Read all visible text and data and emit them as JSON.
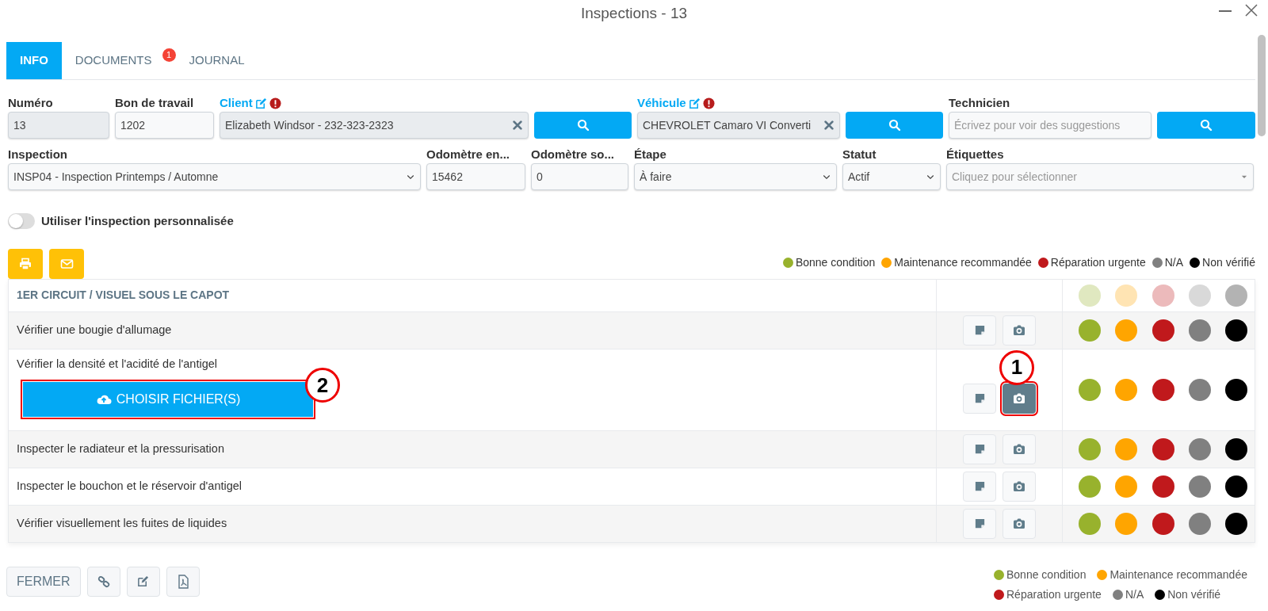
{
  "window": {
    "title": "Inspections - 13"
  },
  "tabs": [
    {
      "label": "INFO",
      "selected": true
    },
    {
      "label": "DOCUMENTS",
      "selected": false,
      "badge": "1"
    },
    {
      "label": "JOURNAL",
      "selected": false
    }
  ],
  "fields_row1": [
    {
      "kind": "text",
      "label": "Numéro",
      "value": "13",
      "readonly": true
    },
    {
      "kind": "text",
      "label": "Bon de travail",
      "value": "1202",
      "readonly": false
    },
    {
      "kind": "lookup",
      "label": "Client",
      "value": "Elizabeth Windsor - 232-323-2323",
      "readonly": true
    },
    {
      "kind": "search"
    },
    {
      "kind": "lookup",
      "label": "Véhicule",
      "value": "CHEVROLET Camaro VI Converti",
      "readonly": true
    },
    {
      "kind": "search"
    },
    {
      "kind": "text",
      "label": "Technicien",
      "placeholder": "Écrivez pour voir des suggestions",
      "readonly": false
    },
    {
      "kind": "search"
    }
  ],
  "fields_row2": [
    {
      "kind": "select",
      "label": "Inspection",
      "value": "INSP04 - Inspection Printemps / Automne"
    },
    {
      "kind": "text",
      "label": "Odomètre en...",
      "value": "15462",
      "readonly": false
    },
    {
      "kind": "text",
      "label": "Odomètre so...",
      "value": "0",
      "readonly": false
    },
    {
      "kind": "select",
      "label": "Étape",
      "value": "À faire"
    },
    {
      "kind": "select",
      "label": "Statut",
      "value": "Actif"
    },
    {
      "kind": "multiselect",
      "label": "Étiquettes",
      "placeholder": "Cliquez pour sélectionner"
    }
  ],
  "toggle": {
    "label": "Utiliser l'inspection personnalisée",
    "on": false
  },
  "legend_top": [
    {
      "label": "Bonne condition",
      "color": "#98b22d"
    },
    {
      "label": "Maintenance recommandée",
      "color": "#ffa500"
    },
    {
      "label": "Réparation urgente",
      "color": "#c0191c"
    },
    {
      "label": "N/A",
      "color": "#808080"
    },
    {
      "label": "Non vérifié",
      "color": "#000000"
    }
  ],
  "section": {
    "title": "1ER CIRCUIT / VISUEL SOUS LE CAPOT",
    "items": [
      {
        "label": "Vérifier une bougie d'allumage",
        "photo_active": false,
        "highlighted": false
      },
      {
        "label": "Vérifier la densité et l'acidité de l'antigel",
        "photo_active": true,
        "highlighted": true,
        "photo_callout": "1",
        "upload_button": "CHOISIR FICHIER(S)",
        "upload_callout": "2"
      },
      {
        "label": "Inspecter le radiateur et la pressurisation",
        "photo_active": false,
        "highlighted": false
      },
      {
        "label": "Inspecter le bouchon et le réservoir d'antigel",
        "photo_active": false,
        "highlighted": false
      },
      {
        "label": "Vérifier visuellement les fuites de liquides",
        "photo_active": false,
        "highlighted": false
      }
    ]
  },
  "footer_buttons": [
    {
      "kind": "text",
      "label": "FERMER"
    },
    {
      "kind": "link"
    },
    {
      "kind": "edit"
    },
    {
      "kind": "pdf"
    }
  ],
  "legend_bottom": [
    {
      "label": "Bonne condition",
      "color": "#98b22d"
    },
    {
      "label": "Maintenance recommandée",
      "color": "#ffa500"
    },
    {
      "label": "Réparation urgente",
      "color": "#c0191c"
    },
    {
      "label": "N/A",
      "color": "#808080"
    },
    {
      "label": "Non vérifié",
      "color": "#000000"
    }
  ]
}
